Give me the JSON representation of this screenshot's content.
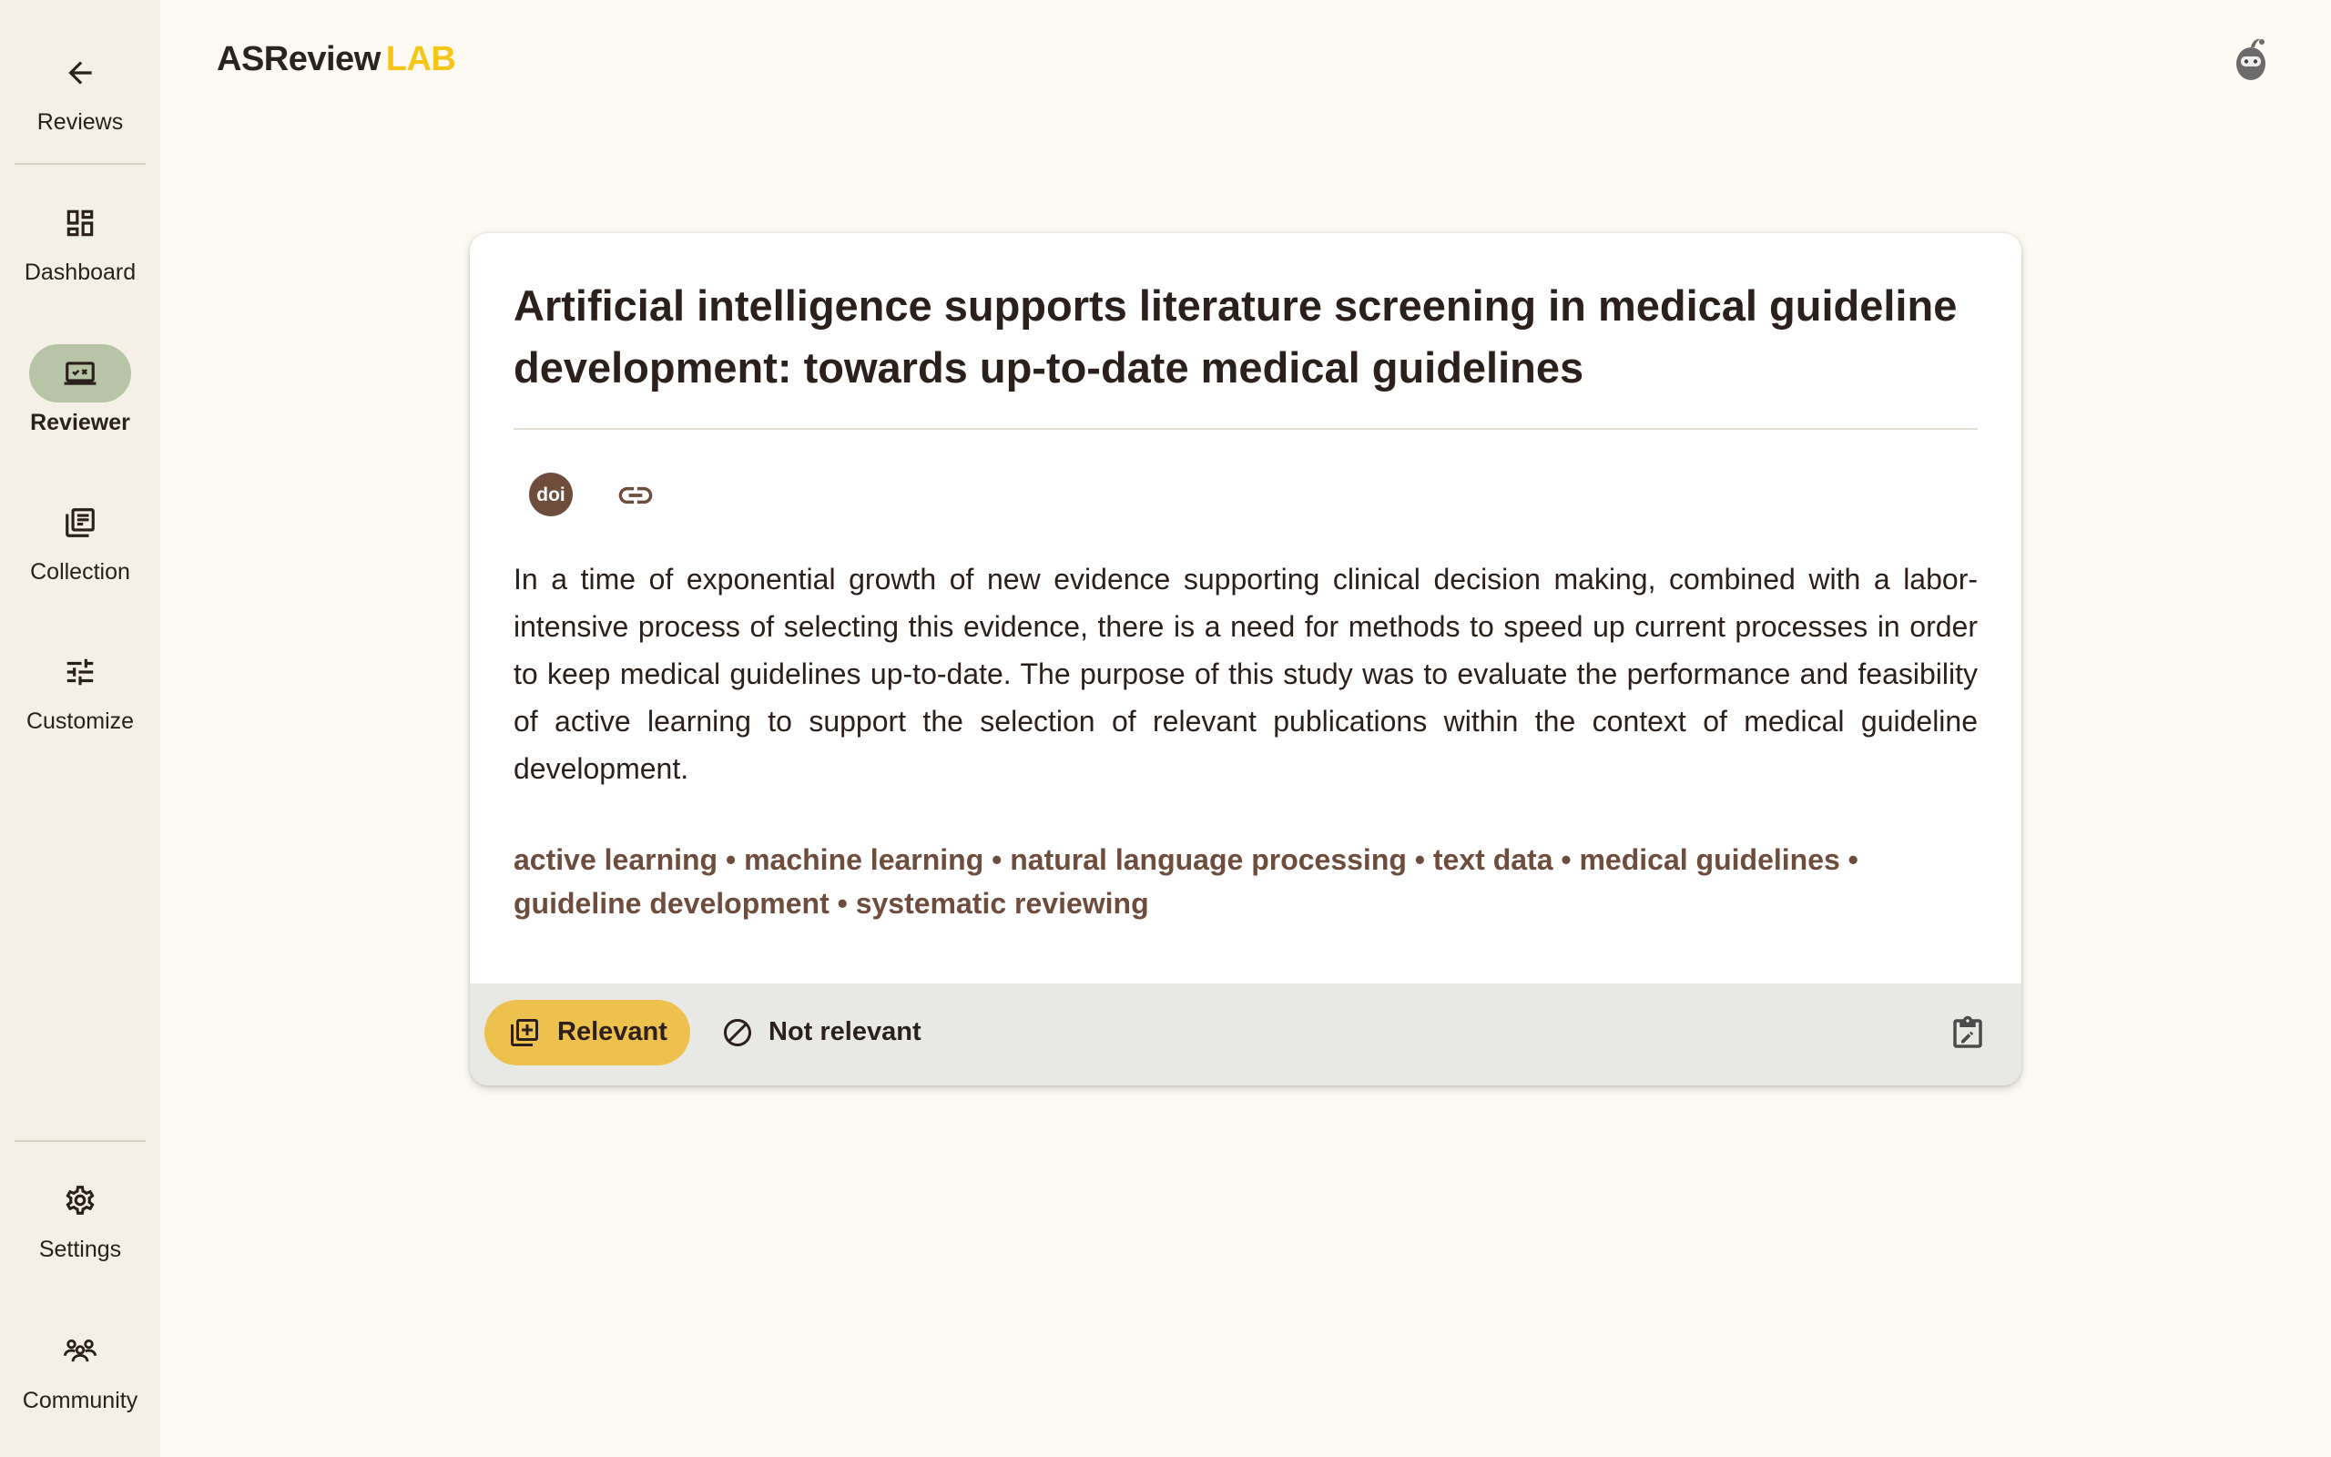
{
  "brand": {
    "name": "ASReview",
    "suffix": "LAB"
  },
  "nav": {
    "reviews": {
      "label": "Reviews",
      "icon": "arrow-back-icon"
    },
    "dashboard": {
      "label": "Dashboard",
      "icon": "dashboard-icon"
    },
    "reviewer": {
      "label": "Reviewer",
      "icon": "reviewer-icon",
      "active": true
    },
    "collection": {
      "label": "Collection",
      "icon": "library-icon"
    },
    "customize": {
      "label": "Customize",
      "icon": "tune-icon"
    },
    "settings": {
      "label": "Settings",
      "icon": "gear-icon"
    },
    "community": {
      "label": "Community",
      "icon": "community-icon"
    }
  },
  "record": {
    "title": "Artificial intelligence supports literature screening in medical guideline development: towards up-to-date medical guidelines",
    "abstract": "In a time of exponential growth of new evidence supporting clinical decision making, combined with a labor-intensive process of selecting this evidence, there is a need for methods to speed up current processes in order to keep medical guidelines up-to-date. The purpose of this study was to evaluate the performance and feasibility of active learning to support the selection of relevant publications within the context of medical guideline development.",
    "keywords": [
      "active learning",
      "machine learning",
      "natural language processing",
      "text data",
      "medical guidelines",
      "guideline development",
      "systematic reviewing"
    ],
    "doi_icon": "doi-icon",
    "link_icon": "link-icon",
    "doi_label": "doi"
  },
  "actions": {
    "relevant_label": "Relevant",
    "irrelevant_label": "Not relevant",
    "note_icon": "edit-note-icon"
  },
  "colors": {
    "accent": "#eec04e",
    "brand_suffix": "#f5c518",
    "active_nav": "#b8c4a6",
    "keyword": "#6e4d3c",
    "background": "#fdfaf4"
  }
}
